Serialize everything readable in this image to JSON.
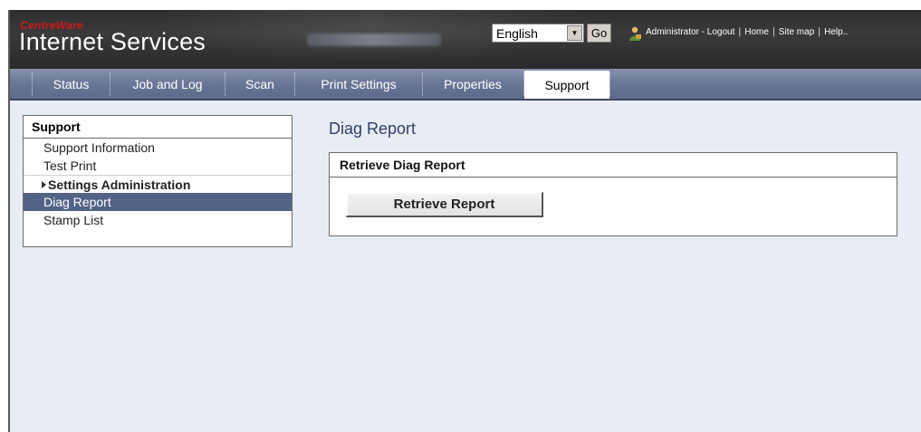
{
  "header": {
    "brand_top": "CentreWare",
    "brand_bottom": "Internet Services",
    "language": "English",
    "go_label": "Go",
    "links": [
      "Administrator - Logout",
      "Home",
      "Site map",
      "Help.."
    ]
  },
  "nav": {
    "tabs": [
      {
        "label": "Status"
      },
      {
        "label": "Job and Log"
      },
      {
        "label": "Scan"
      },
      {
        "label": "Print Settings"
      },
      {
        "label": "Properties"
      },
      {
        "label": "Support",
        "active": true
      }
    ]
  },
  "sidebar": {
    "title": "Support",
    "items": [
      {
        "label": "Support Information"
      },
      {
        "label": "Test Print"
      },
      {
        "label": "Settings Administration",
        "group": true
      },
      {
        "label": "Diag Report",
        "selected": true
      },
      {
        "label": "Stamp List"
      }
    ]
  },
  "main": {
    "title": "Diag Report",
    "panel_title": "Retrieve Diag Report",
    "button_label": "Retrieve Report"
  },
  "colors": {
    "header_bg": "#2e2e2e",
    "nav_bg": "#6c7898",
    "selected_item": "#536386",
    "content_bg": "#e8ecf5",
    "brand_red": "#d11a1a"
  },
  "icons": {
    "admin": "user-admin-icon",
    "dropdown": "chevron-down-icon",
    "group_expander": "triangle-right-icon"
  }
}
